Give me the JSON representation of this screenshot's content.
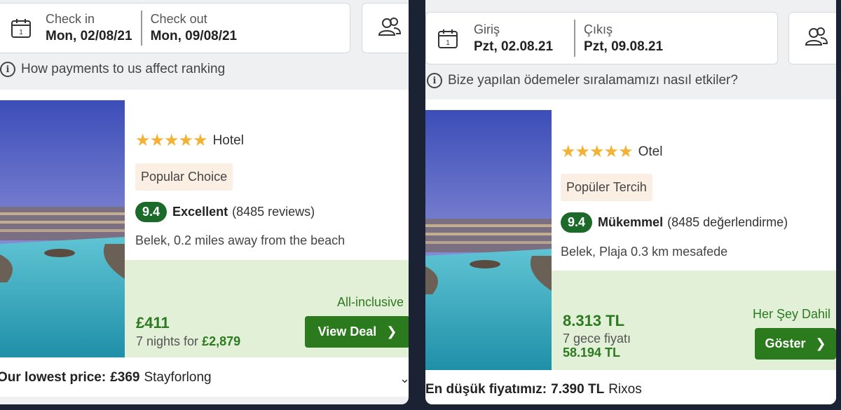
{
  "left": {
    "check_in_label": "Check in",
    "check_in_value": "Mon, 02/08/21",
    "check_out_label": "Check out",
    "check_out_value": "Mon, 09/08/21",
    "info_text": "How payments to us affect ranking",
    "stars": "★★★★★",
    "type": "Hotel",
    "badge": "Popular Choice",
    "score": "9.4",
    "rating_word": "Excellent",
    "reviews": "(8485 reviews)",
    "location": "Belek, 0.2 miles away from the beach",
    "board": "All-inclusive",
    "price": "£411",
    "nights_text": "7 nights for",
    "total": "£2,879",
    "button": "View Deal",
    "lowest_label": "Our lowest price:",
    "lowest_value": "£369",
    "lowest_provider": "Stayforlong"
  },
  "right": {
    "check_in_label": "Giriş",
    "check_in_value": "Pzt, 02.08.21",
    "check_out_label": "Çıkış",
    "check_out_value": "Pzt, 09.08.21",
    "info_text": "Bize yapılan ödemeler sıralamamızı nasıl etkiler?",
    "stars": "★★★★★",
    "type": "Otel",
    "badge": "Popüler Tercih",
    "score": "9.4",
    "rating_word": "Mükemmel",
    "reviews": "(8485 değerlendirme)",
    "location": "Belek, Plaja 0.3 km mesafede",
    "board": "Her Şey Dahil",
    "price": "8.313 TL",
    "nights_text": "7 gece fiyatı",
    "total": "58.194 TL",
    "button": "Göster",
    "lowest_label": "En düşük fiyatımız:",
    "lowest_value": "7.390 TL",
    "lowest_provider": "Rixos"
  }
}
